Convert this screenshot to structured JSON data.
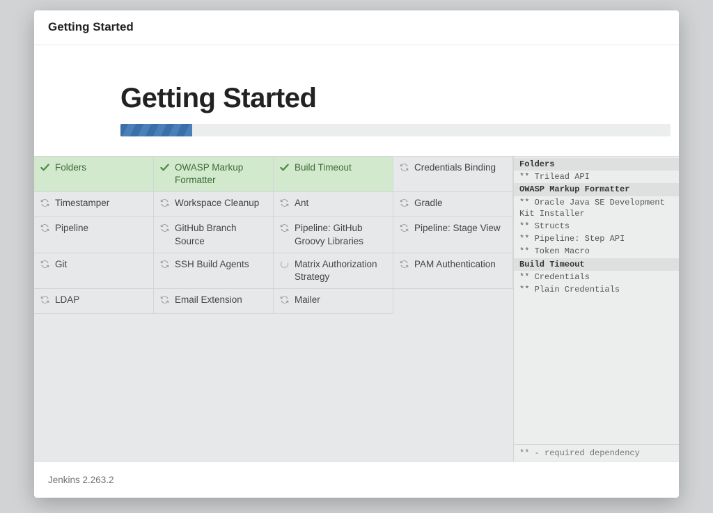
{
  "header": {
    "title": "Getting Started"
  },
  "hero": {
    "title": "Getting Started"
  },
  "progress": {
    "percent": 13
  },
  "plugins": [
    {
      "name": "Folders",
      "state": "success"
    },
    {
      "name": "OWASP Markup Formatter",
      "state": "success"
    },
    {
      "name": "Build Timeout",
      "state": "success"
    },
    {
      "name": "Credentials Binding",
      "state": "pending"
    },
    {
      "name": "Timestamper",
      "state": "pending"
    },
    {
      "name": "Workspace Cleanup",
      "state": "pending"
    },
    {
      "name": "Ant",
      "state": "pending"
    },
    {
      "name": "Gradle",
      "state": "pending"
    },
    {
      "name": "Pipeline",
      "state": "pending"
    },
    {
      "name": "GitHub Branch Source",
      "state": "pending"
    },
    {
      "name": "Pipeline: GitHub Groovy Libraries",
      "state": "pending"
    },
    {
      "name": "Pipeline: Stage View",
      "state": "pending"
    },
    {
      "name": "Git",
      "state": "pending"
    },
    {
      "name": "SSH Build Agents",
      "state": "pending"
    },
    {
      "name": "Matrix Authorization Strategy",
      "state": "loading"
    },
    {
      "name": "PAM Authentication",
      "state": "pending"
    },
    {
      "name": "LDAP",
      "state": "pending"
    },
    {
      "name": "Email Extension",
      "state": "pending"
    },
    {
      "name": "Mailer",
      "state": "pending"
    }
  ],
  "log": [
    {
      "text": "Folders",
      "head": true
    },
    {
      "text": "** Trilead API",
      "head": false
    },
    {
      "text": "OWASP Markup Formatter",
      "head": true
    },
    {
      "text": "** Oracle Java SE Development Kit Installer",
      "head": false
    },
    {
      "text": "** Structs",
      "head": false
    },
    {
      "text": "** Pipeline: Step API",
      "head": false
    },
    {
      "text": "** Token Macro",
      "head": false
    },
    {
      "text": "Build Timeout",
      "head": true
    },
    {
      "text": "** Credentials",
      "head": false
    },
    {
      "text": "** Plain Credentials",
      "head": false
    }
  ],
  "sidebar_foot": "** - required dependency",
  "footer": {
    "version": "Jenkins 2.263.2"
  },
  "icons": {
    "check_color": "#4e8a3f",
    "refresh_color": "#9aa0a6",
    "spinner_color": "#c2c6ca"
  }
}
